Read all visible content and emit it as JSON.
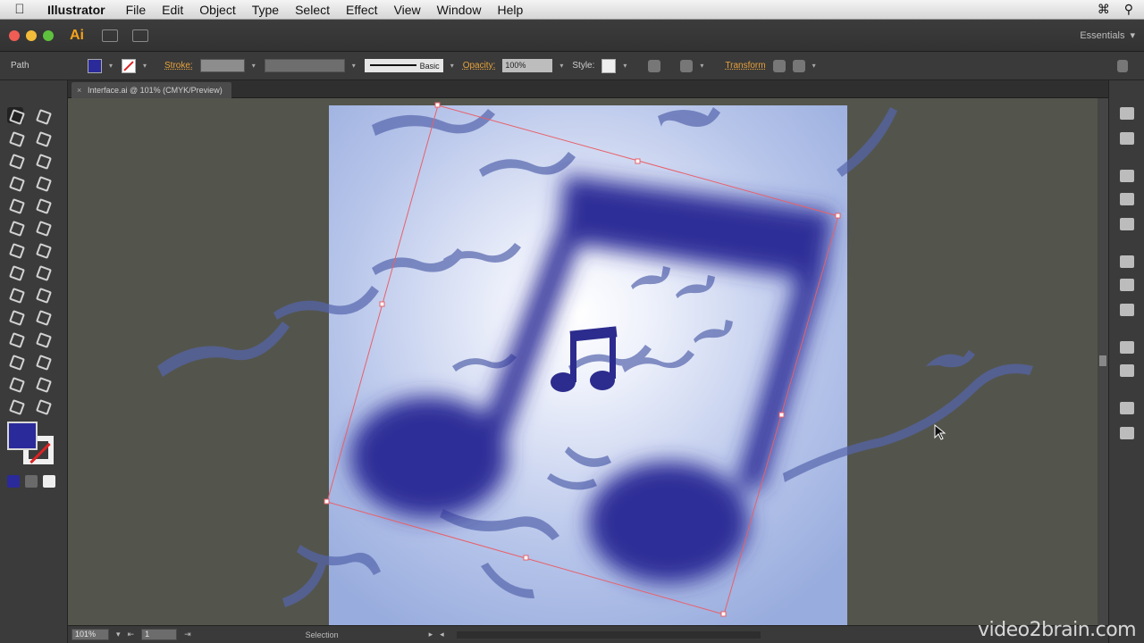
{
  "menubar": {
    "app": "Illustrator",
    "items": [
      "File",
      "Edit",
      "Object",
      "Type",
      "Select",
      "Effect",
      "View",
      "Window",
      "Help"
    ]
  },
  "appbar": {
    "logo": "Ai",
    "workspace": "Essentials"
  },
  "control": {
    "object_type": "Path",
    "stroke_label": "Stroke:",
    "stroke_profile": "Basic",
    "opacity_label": "Opacity:",
    "opacity_value": "100%",
    "style_label": "Style:",
    "transform_label": "Transform",
    "fill_color": "#2b2a9a"
  },
  "document": {
    "tab_title": "Interface.ai @ 101% (CMYK/Preview)"
  },
  "tools": {
    "fill_color": "#2b2a9a"
  },
  "status": {
    "zoom": "101%",
    "page": "1",
    "mode": "Selection"
  },
  "watermark": "video2brain.com"
}
